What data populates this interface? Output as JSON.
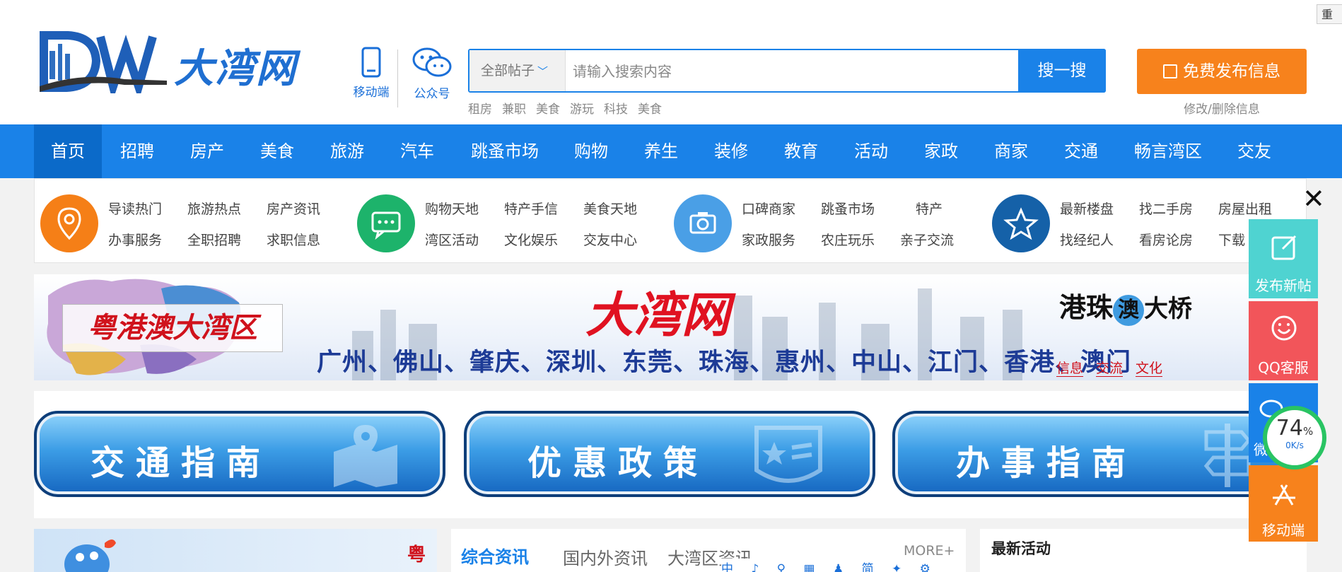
{
  "header": {
    "logo_text": "大湾网",
    "quick_access": {
      "mobile_label": "移动端",
      "wechat_label": "公众号"
    },
    "search": {
      "category_label": "全部帖子",
      "placeholder": "请输入搜索内容",
      "button_label": "搜一搜",
      "hot_tags": [
        "租房",
        "兼职",
        "美食",
        "游玩",
        "科技",
        "美食"
      ]
    },
    "publish_label": "免费发布信息",
    "modify_label": "修改/删除信息"
  },
  "nav": {
    "items": [
      "首页",
      "招聘",
      "房产",
      "美食",
      "旅游",
      "汽车",
      "跳蚤市场",
      "购物",
      "养生",
      "装修",
      "教育",
      "活动",
      "家政",
      "商家",
      "交通",
      "畅言湾区",
      "交友"
    ],
    "active_index": 0
  },
  "quick_links": {
    "groups": [
      {
        "icon": "location-pin-icon",
        "color": "#f57f17",
        "rows": [
          [
            "导读热门",
            "旅游热点",
            "房产资讯"
          ],
          [
            "办事服务",
            "全职招聘",
            "求职信息"
          ]
        ]
      },
      {
        "icon": "chat-bubble-icon",
        "color": "#1db36b",
        "rows": [
          [
            "购物天地",
            "特产手信",
            "美食天地"
          ],
          [
            "湾区活动",
            "文化娱乐",
            "交友中心"
          ]
        ]
      },
      {
        "icon": "camera-icon",
        "color": "#4a9fe6",
        "rows": [
          [
            "口碑商家",
            "跳蚤市场",
            "特产"
          ],
          [
            "家政服务",
            "农庄玩乐",
            "亲子交流"
          ]
        ]
      },
      {
        "icon": "star-icon",
        "color": "#1561a8",
        "rows": [
          [
            "最新楼盘",
            "找二手房",
            "房屋出租"
          ],
          [
            "找经纪人",
            "看房论房",
            "下载"
          ]
        ]
      }
    ]
  },
  "banner": {
    "region_label": "粤港澳大湾区",
    "title": "大湾网",
    "cities": "广州、佛山、肇庆、深圳、东莞、珠海、惠州、中山、江门、香港、澳门",
    "bridge_label_a": "港珠",
    "bridge_label_b": "澳",
    "bridge_label_c": "大桥",
    "tags": [
      "信息",
      "交流",
      "文化"
    ]
  },
  "guides": [
    "交通指南",
    "优惠政策",
    "办事指南"
  ],
  "news": {
    "badge": "粤",
    "tabs": [
      "综合资讯",
      "国内外资讯",
      "大湾区资讯"
    ],
    "more_label": "MORE+",
    "activity_title": "最新活动"
  },
  "floating": {
    "publish_label": "发布新帖",
    "qq_label": "QQ客服",
    "wechat_partial": "微",
    "mobile_label": "移动端",
    "close_symbol": "✕"
  },
  "speed_widget": {
    "percent": "74",
    "percent_sign": "%",
    "rate": "0K/s"
  },
  "top_tab_label": "重",
  "taskbar_text": "中 ♪ ⚲ ▦ ♟ 简 ✦ ⚙"
}
